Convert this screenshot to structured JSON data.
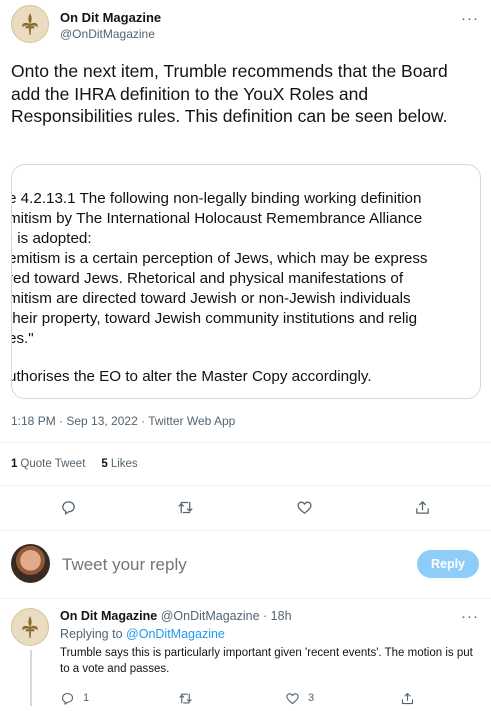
{
  "tweet": {
    "author_name": "On Dit Magazine",
    "author_handle": "@OnDitMagazine",
    "more_glyph": "···",
    "text": "Onto the next item, Trumble recommends that the Board add the IHRA definition to the YouX Roles and Responsibilities rules. This definition can be seen below.",
    "media_lines": [
      "e 4.2.13.1 The following non-legally binding working definition",
      "mitism by The International Holocaust Remembrance Alliance",
      ") is adopted:",
      "emitism is a certain perception of Jews, which may be express",
      "red toward Jews. Rhetorical and physical manifestations of",
      "mitism are directed toward Jewish or non-Jewish individuals",
      "their property, toward Jewish community institutions and relig",
      "es.\"",
      "uthorises the EO to alter the Master Copy accordingly."
    ],
    "timestamp": "1:18 PM · Sep 13, 2022 · Twitter Web App",
    "quote_count": "1",
    "quote_label": "Quote Tweet",
    "like_count": "5",
    "like_label": "Likes"
  },
  "reply_box": {
    "placeholder": "Tweet your reply",
    "button_label": "Reply"
  },
  "reply": {
    "author_name": "On Dit Magazine",
    "meta": "@OnDitMagazine · 18h",
    "replying_prefix": "Replying to",
    "replying_handle": "@OnDitMagazine",
    "text": "Trumble says this is particularly important given 'recent events'. The motion is put to a vote and passes.",
    "reply_count": "1",
    "like_count": "3",
    "more_glyph": "···"
  },
  "icons": {
    "logo": "fleur-de-lis-icon",
    "reply": "speech-bubble-icon",
    "retweet": "retweet-arrows-icon",
    "like": "heart-icon",
    "share": "share-upload-icon"
  },
  "colors": {
    "accent": "#1d9bf0",
    "reply_button": "#8ecdf8",
    "secondary_text": "#536471"
  }
}
